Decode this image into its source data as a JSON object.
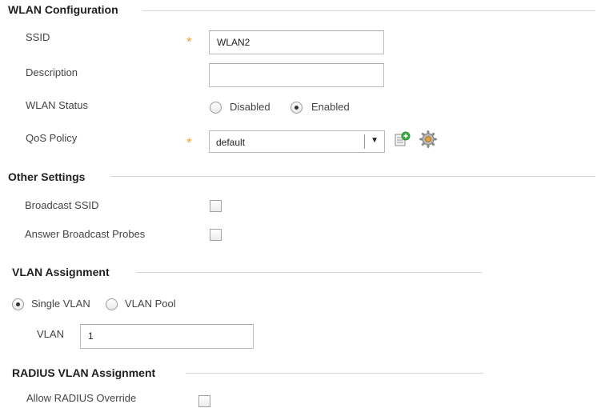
{
  "wlan_config": {
    "title": "WLAN Configuration",
    "ssid_label": "SSID",
    "ssid_value": "WLAN2",
    "description_label": "Description",
    "description_value": "",
    "status_label": "WLAN Status",
    "status_disabled": "Disabled",
    "status_enabled": "Enabled",
    "status_selected": "Enabled",
    "qos_label": "QoS Policy",
    "qos_value": "default",
    "required_mark": "*",
    "dropdown_arrow": "▼"
  },
  "other_settings": {
    "title": "Other Settings",
    "broadcast_ssid_label": "Broadcast SSID",
    "broadcast_ssid_checked": false,
    "answer_probes_label": "Answer Broadcast Probes",
    "answer_probes_checked": false
  },
  "vlan_assignment": {
    "title": "VLAN Assignment",
    "single_vlan": "Single VLAN",
    "vlan_pool": "VLAN Pool",
    "selected": "Single VLAN",
    "vlan_label": "VLAN",
    "vlan_value": "1"
  },
  "radius_vlan": {
    "title": "RADIUS VLAN Assignment",
    "allow_override_label": "Allow RADIUS Override",
    "allow_override_checked": false
  },
  "icons": {
    "create": "add-policy-icon",
    "edit": "gear-icon"
  },
  "colors": {
    "required_star": "#f0a030",
    "section_rule": "#d6d6d6",
    "add_icon_green": "#3fae49"
  }
}
